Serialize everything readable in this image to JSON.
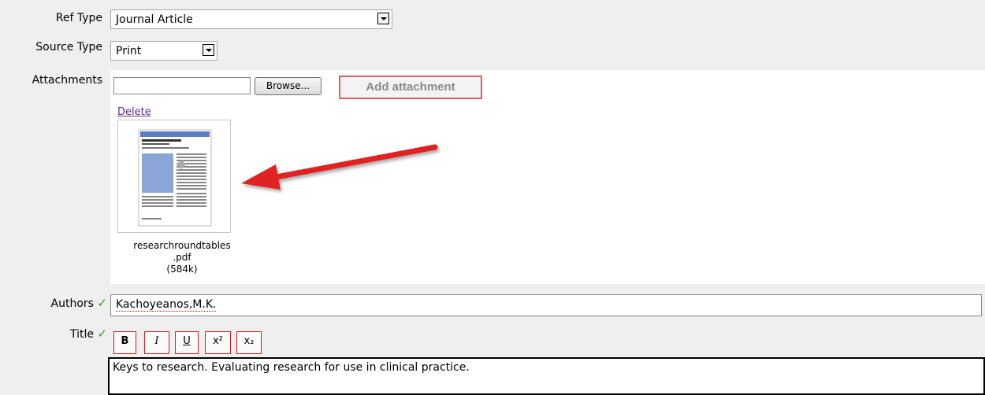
{
  "ref_type": {
    "label": "Ref Type",
    "value": "Journal Article"
  },
  "source_type": {
    "label": "Source Type",
    "value": "Print"
  },
  "attachments": {
    "label": "Attachments",
    "browse_label": "Browse...",
    "add_label": "Add attachment",
    "delete_label": "Delete",
    "file_name_line1": "researchroundtables",
    "file_name_line2": ".pdf",
    "file_size": "(584k)"
  },
  "authors": {
    "label": "Authors",
    "check": "✓",
    "value": "Kachoyeanos,M.K."
  },
  "title": {
    "label": "Title",
    "check": "✓",
    "toolbar": {
      "bold": "B",
      "italic": "I",
      "underline": "U",
      "superscript": "x²",
      "subscript": "x₂"
    },
    "value": "Keys to research. Evaluating research for use in clinical practice."
  },
  "colors": {
    "arrow": "#e02020",
    "button_border": "#cc2222"
  }
}
